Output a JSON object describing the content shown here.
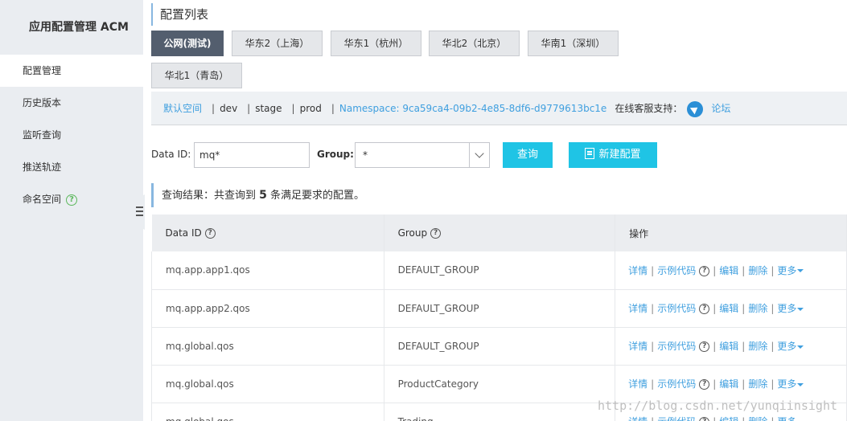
{
  "sidebar": {
    "app_title": "应用配置管理 ACM",
    "items": [
      {
        "label": "配置管理"
      },
      {
        "label": "历史版本"
      },
      {
        "label": "监听查询"
      },
      {
        "label": "推送轨迹"
      },
      {
        "label": "命名空间"
      }
    ],
    "help_glyph": "?"
  },
  "page_title": "配置列表",
  "regions": [
    {
      "label": "公网(测试)"
    },
    {
      "label": "华东2（上海）"
    },
    {
      "label": "华东1（杭州）"
    },
    {
      "label": "华北2（北京）"
    },
    {
      "label": "华南1（深圳）"
    },
    {
      "label": "华北1（青岛）"
    }
  ],
  "namespace_bar": {
    "default_space": "默认空间",
    "dev": "dev",
    "stage": "stage",
    "prod": "prod",
    "namespace": "Namespace: 9ca59ca4-09b2-4e85-8df6-d9779613bc1e",
    "support_label": "在线客服支持：",
    "forum": "论坛"
  },
  "search": {
    "data_id_label": "Data ID:",
    "data_id_value": "mq*",
    "group_label": "Group:",
    "group_value": "*",
    "query_button": "查询",
    "new_button": "新建配置"
  },
  "result": {
    "prefix": "查询结果：共查询到 ",
    "count": "5",
    "suffix": " 条满足要求的配置。"
  },
  "table": {
    "headers": {
      "data_id": "Data ID",
      "group": "Group",
      "ops": "操作"
    },
    "ops": {
      "detail": "详情",
      "sample": "示例代码",
      "edit": "编辑",
      "delete": "删除",
      "more": "更多"
    },
    "rows": [
      {
        "data_id": "mq.app.app1.qos",
        "group": "DEFAULT_GROUP"
      },
      {
        "data_id": "mq.app.app2.qos",
        "group": "DEFAULT_GROUP"
      },
      {
        "data_id": "mq.global.qos",
        "group": "DEFAULT_GROUP"
      },
      {
        "data_id": "mq.global.qos",
        "group": "ProductCategory"
      },
      {
        "data_id": "mq.global.qos",
        "group": "Trading"
      }
    ]
  },
  "watermark": "http://blog.csdn.net/yunqiinsight",
  "colors": {
    "accent": "#1fc4e5",
    "link": "#3f9fdf",
    "active_region": "#535e6e",
    "sidebar_bg": "#eaedf1"
  }
}
